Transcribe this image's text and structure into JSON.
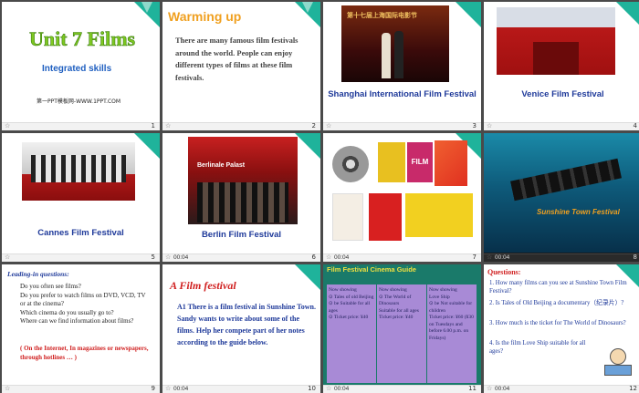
{
  "slides": [
    {
      "num": "1",
      "title": "Unit 7 Films",
      "subtitle": "Integrated skills",
      "credit": "第一PPT模板网-WWW.1PPT.COM"
    },
    {
      "num": "2",
      "title": "Warming up",
      "body": "There are many famous film festivals around the world. People can enjoy different types of films at these film festivals."
    },
    {
      "num": "3",
      "caption": "Shanghai International Film Festival",
      "banner": "第十七届上海国际电影节"
    },
    {
      "num": "4",
      "caption": "Venice Film Festival"
    },
    {
      "num": "5",
      "caption": "Cannes Film Festival"
    },
    {
      "num": "6",
      "caption": "Berlin Film Festival",
      "timer": "00:04",
      "banner": "Berlinale Palast"
    },
    {
      "num": "7",
      "timer": "00:04",
      "poster_text": "FILM"
    },
    {
      "num": "8",
      "timer": "00:04",
      "banner": "Sunshine Town Festival"
    },
    {
      "num": "9",
      "heading": "Leading-in questions:",
      "questions": "Do you often see films?\nDo you prefer to watch films on DVD, VCD, TV or at the cinema?\nWhich cinema do you usually go to?\nWhere can we find information about films?",
      "answer": "( On the Internet, In magazines or newspapers, through hotlines … )"
    },
    {
      "num": "10",
      "timer": "00:04",
      "heading": "A Film festival",
      "body": "A1 There is a film festival in Sunshine Town. Sandy wants to write about some of the films. Help her compete part of her notes according to the guide below."
    },
    {
      "num": "11",
      "timer": "00:04",
      "heading": "Film Festival Cinema Guide",
      "columns": [
        "Now showing\n⊙ Tales of old Beijing\n⊙ be Suitable for all ages\n⊙ Ticket price: ¥40",
        "Now showing\n⊙ The World of Dinosaurs\nSuitable for all ages\nTicket price: ¥40",
        "Now showing\nLove Ship\n⊙ be Not suitable for children\nTicket price: ¥60 (¥30 on Tuesdays and before 6.00 p.m. on Fridays)"
      ]
    },
    {
      "num": "12",
      "timer": "00:04",
      "heading": "Questions:",
      "questions": [
        "1. How many films can you see at Sunshine Town Film Festival?",
        "2. Is Tales of Old Beijing a documentary（纪录片）?",
        "3. How much is the ticket for The World of Dinosaurs?",
        "4. Is the film Love Ship suitable for all ages?"
      ]
    }
  ],
  "colors": {
    "teal": "#1fb39b",
    "navy": "#1f3a9a",
    "purple": "#a88ad6",
    "orange": "#f0a020"
  },
  "icons": {
    "star": "☆"
  }
}
